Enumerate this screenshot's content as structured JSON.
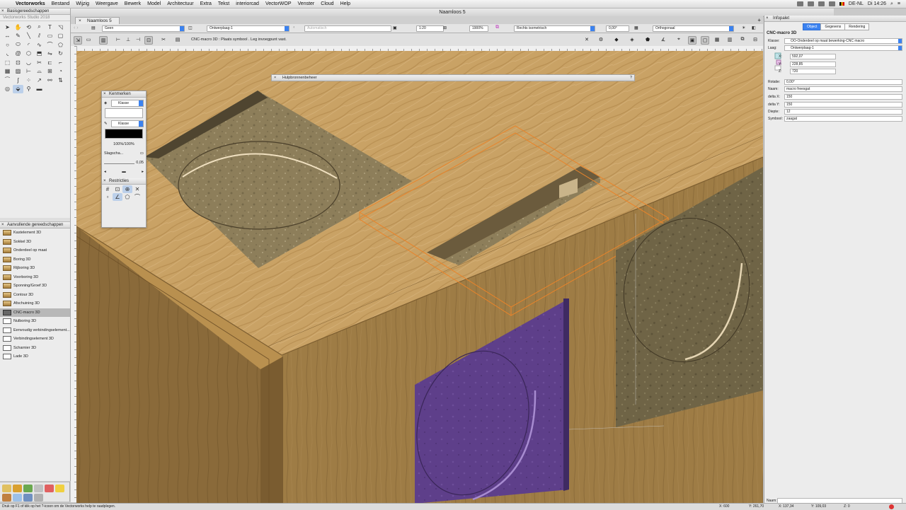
{
  "menubar": {
    "app_name": "Vectorworks",
    "items": [
      "Bestand",
      "Wijzig",
      "Weergave",
      "Bewerk",
      "Model",
      "Architectuur",
      "Extra",
      "Tekst",
      "interiorcad",
      "VectorWOP",
      "Venster",
      "Cloud",
      "Help"
    ],
    "clock": "Di 14:26",
    "input_lang": "DE-NL"
  },
  "tool_palette": {
    "title": "Basisgereedschappen",
    "subtitle": "Vectorworks Studio 2018"
  },
  "extra_tools": {
    "title": "Aanvullende gereedschappen",
    "items": [
      "Kastelement 3D",
      "Sokkel 3D",
      "Onderdeel op maat",
      "Boring 3D",
      "Rijboring 3D",
      "Voorboring 3D",
      "Sponning/Groef 3D",
      "Contour 3D",
      "Afschuining 3D",
      "CNC-macro 3D",
      "Nulboring 3D",
      "Eenvoudig verbindingselement...",
      "Verbindingselement 3D",
      "Scharnier 3D",
      "Lade 3D"
    ],
    "selected_index": 9
  },
  "document": {
    "title": "Naamloos 5",
    "tab": "Naamloos 5"
  },
  "view_bar": {
    "class": "Geen",
    "layer": "Ontwerplaag-1",
    "render": "Automatisch",
    "scale": "1:20",
    "zoom": "1900%",
    "view": "Rechts isometrisch",
    "angle": "0,00°",
    "projection": "Orthogonaal"
  },
  "mode_bar": {
    "hint": "CNC-macro 3D : Plaats symbool . Leg invoegpunt vast."
  },
  "resource_manager": {
    "title": "Hulpbronnenbeheer",
    "help": "?"
  },
  "attributes": {
    "title": "Kenmerken",
    "fill_class": "Klasse",
    "pen_class": "Klasse",
    "opacity": "100%/100%",
    "shadow_label": "Slagscha...",
    "line_weight": "0,05"
  },
  "constraints": {
    "title": "Restricties"
  },
  "info_palette": {
    "title": "Infopalet",
    "tabs": [
      "Object",
      "Gegevens",
      "Rendering"
    ],
    "active_tab": 0,
    "object_type": "CNC-macro 3D",
    "klasse_label": "Klasse:",
    "klasse": "OO-Onderdeel op maat bewerking-CNC macro",
    "laag_label": "Laag:",
    "laag": "Ontwerplaag-1",
    "x_label": "X:",
    "x": "592,07",
    "y_label": "Y:",
    "y": "228,85",
    "z_label": "Z:",
    "z": "720",
    "rotatie_label": "Rotatie:",
    "rotatie": "0,00°",
    "naam_label": "Naam:",
    "naam": "macro freesgat",
    "delta_x_label": "delta X:",
    "delta_x": "150",
    "delta_y_label": "delta Y:",
    "delta_y": "150",
    "diepte_label": "Diepte:",
    "diepte": "12",
    "symbool_label": "Symbool:",
    "symbool": "zaagat",
    "footer_naam_label": "Naam:"
  },
  "status_bar": {
    "message": "Druk op F1 of klik op het ?-icoon om de Vectorworks help te raadplegen.",
    "x_coord": "X: 600",
    "y_coord": "Y: 261,70",
    "x2_coord": "X: 137,34",
    "y2_coord": "Y: 109,03",
    "z_coord": "Z: 0"
  },
  "colors": {
    "accent": "#3b82f0",
    "wood": "#c9a265",
    "wood_shadow": "#9e7c45",
    "chipboard": "#8d7e5a",
    "purple": "#5e3f8a",
    "orange_outline": "#e9842a"
  }
}
